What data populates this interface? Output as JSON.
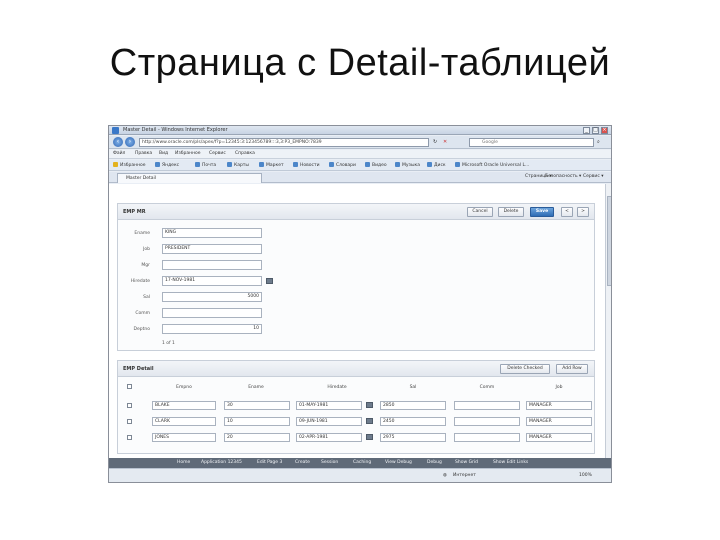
{
  "slide": {
    "title": "Страница с Detail-таблицей"
  },
  "browser": {
    "window_title": "Master Detail - Windows Internet Explorer",
    "address": "http://www.oracle.com/pls/apex/f?p=12345:3:123456789:::3,3:P3_EMPNO:7839",
    "search_placeholder": "Google",
    "menu": [
      "Файл",
      "Правка",
      "Вид",
      "Избранное",
      "Сервис",
      "Справка"
    ],
    "favorites_label": "Избранное",
    "favorites": [
      "Яндекс",
      "Почта",
      "Карты",
      "Маркет",
      "Новости",
      "Словари",
      "Видео",
      "Музыка",
      "Диск",
      "Microsoft Oracle Universal L..."
    ],
    "tab_label": "Master Detail",
    "tab_tools": [
      "Страница ▾",
      "Безопасность ▾",
      "Сервис ▾"
    ],
    "zoom": "100%",
    "status_text": "Интернет"
  },
  "emp_form": {
    "header": "EMP MR",
    "buttons": {
      "cancel": "Cancel",
      "delete": "Delete",
      "save": "Save",
      "prev": "<",
      "next": ">"
    },
    "fields": [
      {
        "label": "Ename",
        "value": "KING"
      },
      {
        "label": "Job",
        "value": "PRESIDENT"
      },
      {
        "label": "Mgr",
        "value": ""
      },
      {
        "label": "Hiredate",
        "value": "17-NOV-1981"
      },
      {
        "label": "Sal",
        "value": "5000"
      },
      {
        "label": "Comm",
        "value": ""
      },
      {
        "label": "Deptno",
        "value": "10"
      }
    ],
    "pagination": "1 of 1"
  },
  "emp_detail": {
    "header": "EMP Detail",
    "buttons": {
      "delete_checked": "Delete Checked",
      "add_row": "Add Row"
    },
    "columns": [
      "Empno",
      "Ename",
      "Hiredate",
      "Sal",
      "Comm",
      "Job"
    ],
    "rows": [
      {
        "empno": "BLAKE",
        "ename": "30",
        "hiredate": "01-MAY-1981",
        "sal": "2850",
        "comm": "",
        "job": "MANAGER"
      },
      {
        "empno": "CLARK",
        "ename": "10",
        "hiredate": "09-JUN-1981",
        "sal": "2450",
        "comm": "",
        "job": "MANAGER"
      },
      {
        "empno": "JONES",
        "ename": "20",
        "hiredate": "02-APR-1981",
        "sal": "2975",
        "comm": "",
        "job": "MANAGER"
      }
    ]
  },
  "dev_toolbar": [
    "Home",
    "Application 12345",
    "Edit Page 3",
    "Create",
    "Session",
    "Caching",
    "View Debug",
    "Debug",
    "Show Grid",
    "Show Edit Links"
  ]
}
